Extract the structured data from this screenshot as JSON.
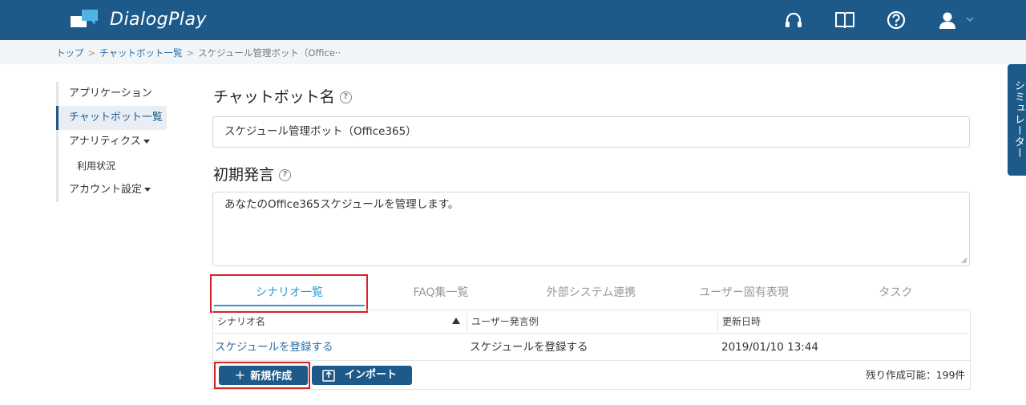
{
  "header": {
    "brand": "DialogPlay",
    "icons": [
      "headset-icon",
      "book-icon",
      "help-icon",
      "user-icon",
      "chevron-down-icon"
    ]
  },
  "breadcrumb": {
    "items": [
      "トップ",
      "チャットボット一覧"
    ],
    "current": "スケジュール管理ボット（Office··"
  },
  "sidebar": {
    "items": [
      {
        "label": "アプリケーション"
      },
      {
        "label": "チャットボット一覧"
      },
      {
        "label": "アナリティクス"
      },
      {
        "label": "利用状況"
      },
      {
        "label": "アカウント設定"
      }
    ]
  },
  "form": {
    "name_label": "チャットボット名",
    "name_value": "スケジュール管理ボット（Office365）",
    "greeting_label": "初期発言",
    "greeting_value": "あなたのOffice365スケジュールを管理します。"
  },
  "tabs": [
    {
      "label": "シナリオ一覧"
    },
    {
      "label": "FAQ集一覧"
    },
    {
      "label": "外部システム連携"
    },
    {
      "label": "ユーザー固有表現"
    },
    {
      "label": "タスク"
    }
  ],
  "table": {
    "columns": [
      "シナリオ名",
      "ユーザー発言例",
      "更新日時"
    ],
    "rows": [
      {
        "name": "スケジュールを登録する",
        "example": "スケジュールを登録する",
        "updated": "2019/01/10 13:44"
      }
    ]
  },
  "actions": {
    "new_label": "新規作成",
    "import_label": "インポート",
    "remaining": "残り作成可能：199件"
  },
  "simulator": {
    "label": "シミュレーター"
  },
  "colors": {
    "header": "#1d5a8a",
    "accent": "#2b9bd3",
    "highlight": "#d6232a"
  }
}
